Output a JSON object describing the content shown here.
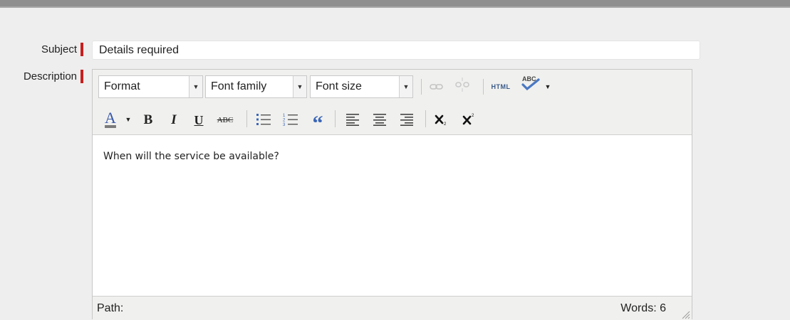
{
  "form": {
    "subject_label": "Subject",
    "subject_value": "Details required",
    "description_label": "Description"
  },
  "toolbar": {
    "format": "Format",
    "font_family": "Font family",
    "font_size": "Font size",
    "html_label": "HTML",
    "spell_label": "ABC",
    "font_color_label": "A",
    "bold": "B",
    "italic": "I",
    "underline": "U",
    "strike": "ABC",
    "blockquote": "“"
  },
  "editor": {
    "content": "When will the service be available?"
  },
  "statusbar": {
    "path_label": "Path:",
    "word_count": "Words: 6"
  },
  "colors": {
    "required_marker": "#c81e1e",
    "font_color_underline": "#7a7a7a"
  }
}
